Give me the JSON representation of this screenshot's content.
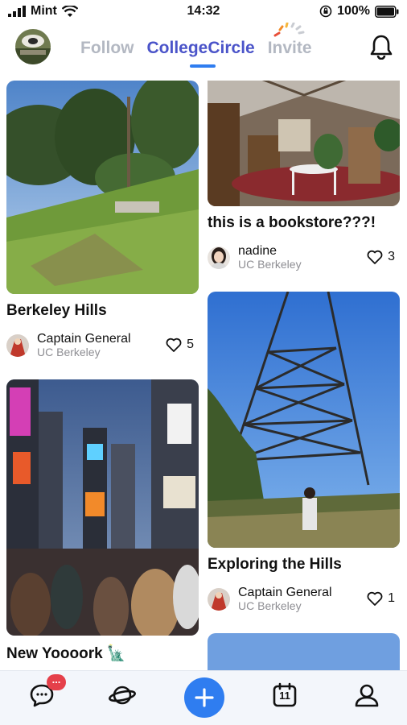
{
  "status_bar": {
    "carrier": "Mint",
    "time": "14:32",
    "battery": "100%"
  },
  "header": {
    "tabs": [
      {
        "label": "Follow",
        "active": false
      },
      {
        "label": "CollegeCircle",
        "active": true
      },
      {
        "label": "Invite",
        "active": false
      }
    ]
  },
  "feed": {
    "cards": [
      {
        "title": "Berkeley Hills",
        "author": "Captain General",
        "school": "UC Berkeley",
        "likes": "5"
      },
      {
        "title": "this is a bookstore???!",
        "author": "nadine",
        "school": "UC Berkeley",
        "likes": "3"
      },
      {
        "title": "New Yoooork 🗽",
        "author": "",
        "school": "",
        "likes": ""
      },
      {
        "title": "Exploring the Hills",
        "author": "Captain General",
        "school": "UC Berkeley",
        "likes": "1"
      }
    ]
  },
  "tab_bar": {
    "items": [
      {
        "icon": "chat-icon",
        "badge": "..."
      },
      {
        "icon": "planet-icon"
      },
      {
        "icon": "plus-icon"
      },
      {
        "icon": "calendar-icon",
        "label": "11"
      },
      {
        "icon": "profile-icon"
      }
    ]
  },
  "colors": {
    "accent": "#2f7df0",
    "active_tab": "#4b54c9",
    "inactive_tab": "#b3b8c2",
    "badge": "#e5404a"
  }
}
